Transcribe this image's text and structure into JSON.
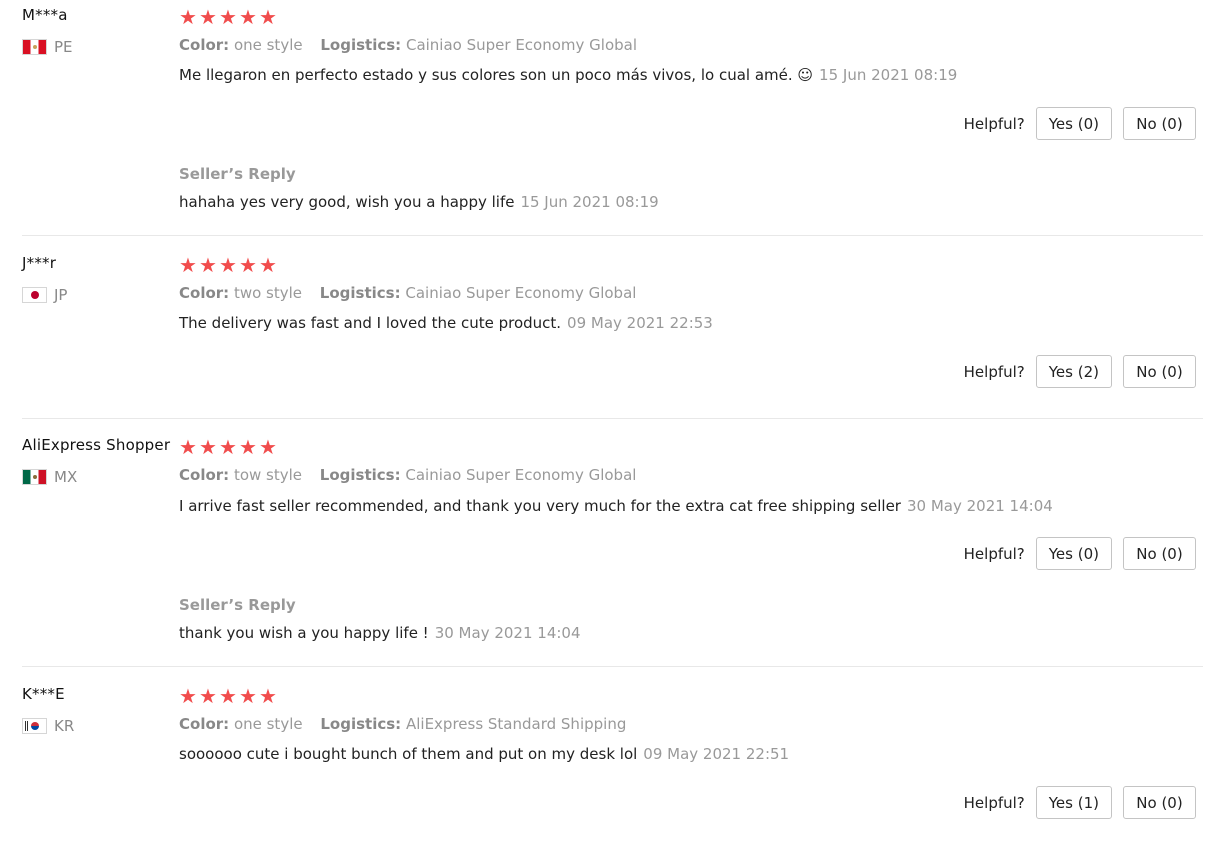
{
  "labels": {
    "color": "Color:",
    "logistics": "Logistics:",
    "helpful": "Helpful?",
    "seller_reply": "Seller’s Reply"
  },
  "star_color": "#f14c4c",
  "reviews": [
    {
      "name": "M***a",
      "country": "PE",
      "flag_icon": "peru-flag-icon",
      "rating": 5,
      "color": "one style",
      "logistics": "Cainiao Super Economy Global",
      "text": "Me llegaron en perfecto estado y sus colores son un poco más vivos, lo cual amé. ☺",
      "date": "15 Jun 2021 08:19",
      "yes": "Yes (0)",
      "no": "No (0)",
      "reply_text": "hahaha yes very good, wish you a happy life",
      "reply_date": "15 Jun 2021 08:19"
    },
    {
      "name": "J***r",
      "country": "JP",
      "flag_icon": "japan-flag-icon",
      "rating": 5,
      "color": "two style",
      "logistics": "Cainiao Super Economy Global",
      "text": "The delivery was fast and I loved the cute product.",
      "date": "09 May 2021 22:53",
      "yes": "Yes (2)",
      "no": "No (0)"
    },
    {
      "name": "AliExpress Shopper",
      "country": "MX",
      "flag_icon": "mexico-flag-icon",
      "rating": 5,
      "color": "tow style",
      "logistics": "Cainiao Super Economy Global",
      "text": "I arrive fast seller recommended, and thank you very much for the extra cat free shipping seller",
      "date": "30 May 2021 14:04",
      "yes": "Yes (0)",
      "no": "No (0)",
      "reply_text": "thank you wish a you happy life !",
      "reply_date": "30 May 2021 14:04"
    },
    {
      "name": "K***E",
      "country": "KR",
      "flag_icon": "korea-flag-icon",
      "rating": 5,
      "color": "one style",
      "logistics": "AliExpress Standard Shipping",
      "text": "soooooo cute i bought bunch of them and put on my desk lol",
      "date": "09 May 2021 22:51",
      "yes": "Yes (1)",
      "no": "No (0)"
    }
  ]
}
